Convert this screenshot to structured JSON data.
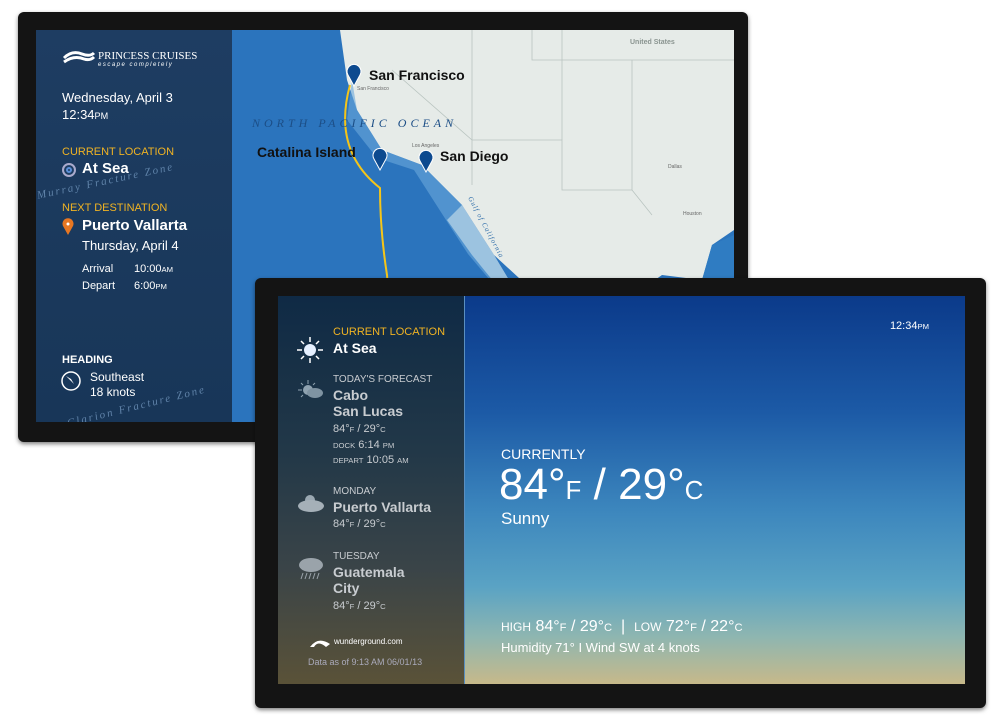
{
  "screen1": {
    "brand": {
      "name": "PRINCESS CRUISES",
      "tagline": "escape completely"
    },
    "date": "Wednesday, April 3",
    "time": "12:34",
    "time_suffix": "PM",
    "current_location": {
      "label": "CURRENT LOCATION",
      "value": "At Sea"
    },
    "next_destination": {
      "label": "NEXT DESTINATION",
      "name": "Puerto Vallarta",
      "date": "Thursday, April 4",
      "arrival_label": "Arrival",
      "arrival_time": "10:00",
      "arrival_suffix": "AM",
      "depart_label": "Depart",
      "depart_time": "6:00",
      "depart_suffix": "PM"
    },
    "heading": {
      "label": "HEADING",
      "direction": "Southeast",
      "speed": "18 knots"
    },
    "map": {
      "ocean_label": "NORTH PACIFIC OCEAN",
      "country_label": "United States",
      "pins": [
        "San Francisco",
        "Catalina Island",
        "San Diego"
      ],
      "small_labels": [
        "San Francisco",
        "Los Angeles",
        "Dallas",
        "Houston",
        "Gulf of California",
        "Murray Fracture Zone",
        "Clarion Fracture Zone"
      ],
      "route_color": "#f5c518",
      "pin_color": "#0d4a8f",
      "accent_color": "#f0b323"
    }
  },
  "screen2": {
    "time": "12:34",
    "time_suffix": "PM",
    "current": {
      "label": "CURRENT LOCATION",
      "value": "At Sea",
      "icon": "sun-icon"
    },
    "today": {
      "label": "TODAY'S FORECAST",
      "city1": "Cabo",
      "city2": "San Lucas",
      "temp_f": "84°",
      "temp_c": "29°",
      "dock_label": "DOCK",
      "dock_time": "6:14",
      "dock_suffix": "PM",
      "depart_label": "DEPART",
      "depart_time": "10:05",
      "depart_suffix": "AM",
      "icon": "partly-sunny-icon"
    },
    "monday": {
      "label": "MONDAY",
      "city1": "Puerto Vallarta",
      "temp_f": "84°",
      "temp_c": "29°",
      "icon": "partly-cloudy-icon"
    },
    "tuesday": {
      "label": "TUESDAY",
      "city1": "Guatemala",
      "city2": "City",
      "temp_f": "84°",
      "temp_c": "29°",
      "icon": "rain-icon"
    },
    "provider": "wunderground.com",
    "data_as_of": "Data as of 9:13 AM 06/01/13",
    "currently": {
      "label": "CURRENTLY",
      "temp_f": "84°",
      "temp_c": "29°",
      "condition": "Sunny"
    },
    "high_label": "HIGH",
    "high_f": "84°",
    "high_c": "29°",
    "low_label": "LOW",
    "low_f": "72°",
    "low_c": "22°",
    "details": "Humidity 71° I Wind SW at 4 knots"
  }
}
